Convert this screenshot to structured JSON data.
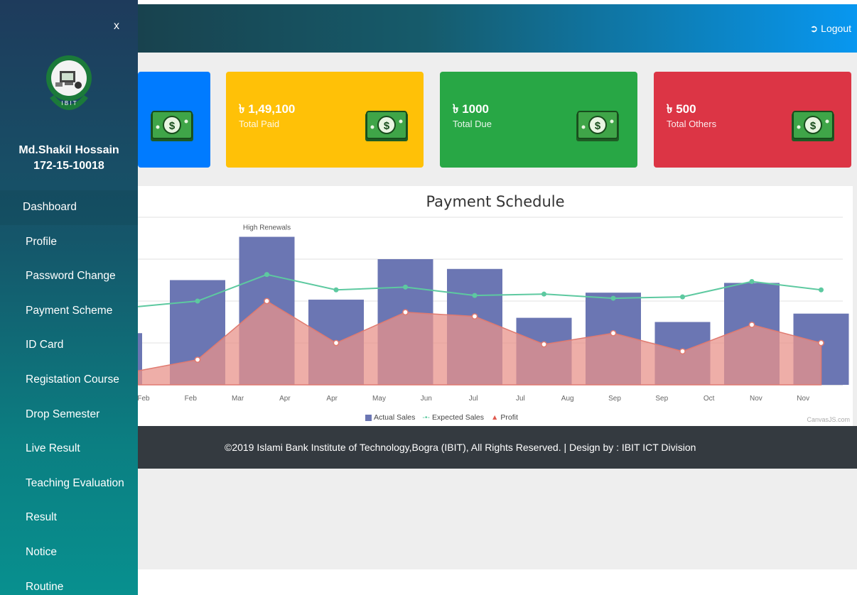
{
  "sidebar": {
    "close": "x",
    "student_name": "Md.Shakil Hossain",
    "student_id": "172-15-10018",
    "items": [
      {
        "label": "Dashboard"
      },
      {
        "label": "Profile"
      },
      {
        "label": "Password Change"
      },
      {
        "label": "Payment Scheme"
      },
      {
        "label": "ID Card"
      },
      {
        "label": "Registation Course"
      },
      {
        "label": "Drop Semester"
      },
      {
        "label": "Live Result"
      },
      {
        "label": "Teaching Evaluation"
      },
      {
        "label": "Result"
      },
      {
        "label": "Notice"
      },
      {
        "label": "Routine"
      }
    ]
  },
  "header": {
    "logout": "Logout",
    "logout_icon": "sign-out-icon"
  },
  "cards": [
    {
      "amount": "",
      "label": "",
      "color": "#007bff",
      "icon": "money-icon"
    },
    {
      "amount": "৳ 1,49,100",
      "label": "Total Paid",
      "color": "#ffc107",
      "icon": "money-icon"
    },
    {
      "amount": "৳ 1000",
      "label": "Total Due",
      "color": "#28a745",
      "icon": "money-icon"
    },
    {
      "amount": "৳ 500",
      "label": "Total Others",
      "color": "#dc3545",
      "icon": "money-icon"
    }
  ],
  "chart_data": {
    "type": "bar",
    "title": "Payment Schedule",
    "x_tick_labels": [
      "Feb",
      "Feb",
      "Mar",
      "Apr",
      "Apr",
      "May",
      "Jun",
      "Jul",
      "Jul",
      "Aug",
      "Sep",
      "Sep",
      "Oct",
      "Nov",
      "Nov"
    ],
    "categories": [
      "Feb",
      "Mar",
      "Apr",
      "May",
      "Jun",
      "Jul",
      "Aug",
      "Sep",
      "Oct",
      "Nov"
    ],
    "series": [
      {
        "name": "Actual Sales",
        "kind": "column",
        "color": "#6b76b3",
        "values": [
          75000,
          106000,
          61000,
          90000,
          83000,
          48000,
          66000,
          45000,
          73000,
          51000
        ]
      },
      {
        "name": "Expected Sales",
        "kind": "line",
        "color": "#5dc9a0",
        "values": [
          60000,
          79000,
          68000,
          70000,
          64000,
          65000,
          62000,
          63000,
          74000,
          68000
        ]
      },
      {
        "name": "Profit",
        "kind": "area",
        "color": "#e8938b",
        "values": [
          18000,
          60000,
          30000,
          52000,
          49000,
          29000,
          37000,
          24000,
          43000,
          30000
        ]
      }
    ],
    "partial_left": {
      "actual": 37000,
      "expected": 56000,
      "profit": 10000
    },
    "annotation": "High Renewals",
    "legend": [
      "Actual Sales",
      "Expected Sales",
      "Profit"
    ],
    "legend_position": "bottom-center",
    "credit": "CanvasJS.com",
    "ylim": [
      0,
      120000
    ],
    "grid": true
  },
  "footer": {
    "text": "©2019 Islami Bank Institute of Technology,Bogra (IBIT), All Rights Reserved. | Design by : IBIT ICT Division"
  }
}
